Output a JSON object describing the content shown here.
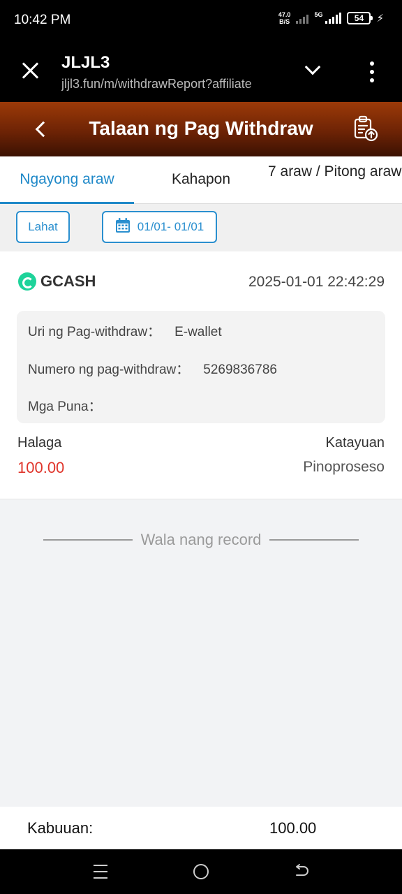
{
  "status_bar": {
    "time": "10:42 PM",
    "net_speed_value": "47.0",
    "net_speed_unit": "B/S",
    "network": "5G",
    "battery": "54"
  },
  "browser": {
    "title": "JLJL3",
    "url": "jljl3.fun/m/withdrawReport?affiliate"
  },
  "header": {
    "title": "Talaan ng Pag Withdraw"
  },
  "tabs": [
    {
      "label": "Ngayong araw",
      "active": true
    },
    {
      "label": "Kahapon",
      "active": false
    },
    {
      "label": "7 araw / Pitong araw",
      "active": false
    }
  ],
  "filters": {
    "all_label": "Lahat",
    "date_range": "01/01- 01/01"
  },
  "record": {
    "provider": "GCASH",
    "datetime": "2025-01-01 22:42:29",
    "type_label": "Uri ng Pag-withdraw：",
    "type_value": "E-wallet",
    "number_label": "Numero ng pag-withdraw：",
    "number_value": "5269836786",
    "remarks_label": "Mga Puna：",
    "remarks_value": "",
    "amount_label": "Halaga",
    "amount_value": "100.00",
    "status_label": "Katayuan",
    "status_value": "Pinoproseso"
  },
  "empty_text": "Wala nang record",
  "total": {
    "label": "Kabuuan:",
    "value": "100.00"
  },
  "colors": {
    "accent": "#1e88c8",
    "header_dark": "#6d2305",
    "amount": "#e0352b",
    "gcash": "#1ed39a"
  }
}
